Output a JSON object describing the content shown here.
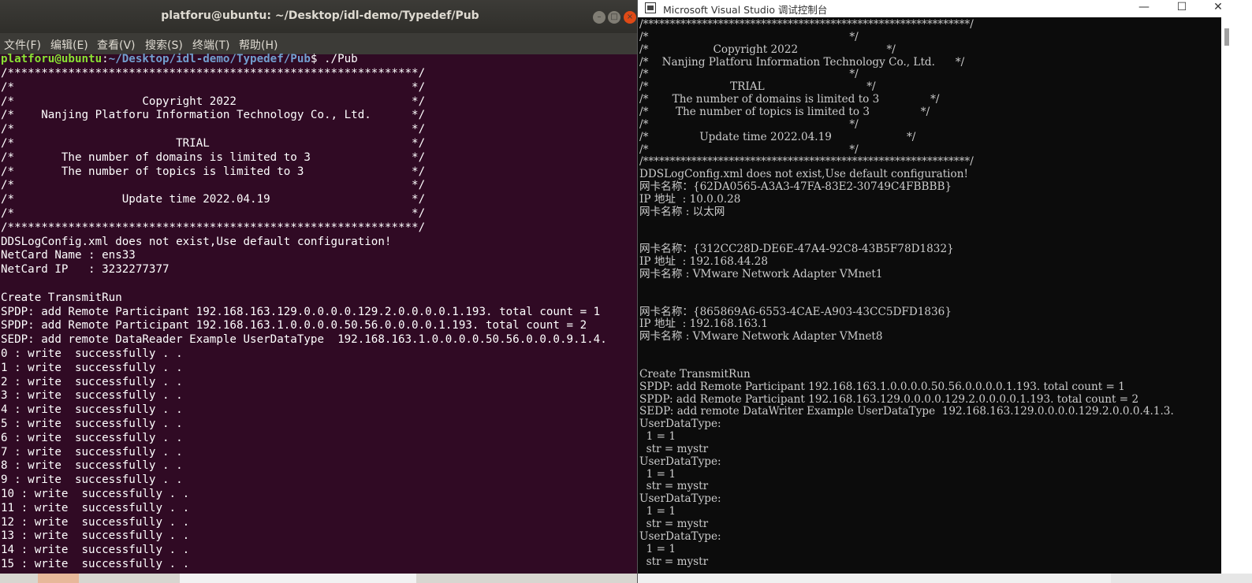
{
  "ubuntu": {
    "title": "platforu@ubuntu: ~/Desktop/idl-demo/Typedef/Pub",
    "controls": {
      "minimize": "–",
      "maximize": "□",
      "close": "×"
    },
    "menus": [
      "文件(F)",
      "编辑(E)",
      "查看(V)",
      "搜索(S)",
      "终端(T)",
      "帮助(H)"
    ],
    "prompt": {
      "user": "platforu@ubuntu",
      "sep": ":",
      "path": "~/Desktop/idl-demo/Typedef/Pub",
      "cmd": "$ ./Pub"
    },
    "lines": [
      "/*************************************************************/",
      "/*                                                           */",
      "/*                   Copyright 2022                          */",
      "/*    Nanjing Platforu Information Technology Co., Ltd.      */",
      "/*                                                           */",
      "/*                        TRIAL                              */",
      "/*       The number of domains is limited to 3               */",
      "/*       The number of topics is limited to 3                */",
      "/*                                                           */",
      "/*                Update time 2022.04.19                     */",
      "/*                                                           */",
      "/*************************************************************/",
      "DDSLogConfig.xml does not exist,Use default configuration!",
      "NetCard Name : ens33",
      "NetCard IP   : 3232277377",
      "",
      "Create TransmitRun",
      "SPDP: add Remote Participant 192.168.163.129.0.0.0.0.129.2.0.0.0.0.1.193. total count = 1",
      "SPDP: add Remote Participant 192.168.163.1.0.0.0.0.50.56.0.0.0.0.1.193. total count = 2",
      "SEDP: add remote DataReader Example UserDataType  192.168.163.1.0.0.0.0.50.56.0.0.0.9.1.4.",
      "0 : write  successfully . .",
      "1 : write  successfully . .",
      "2 : write  successfully . .",
      "3 : write  successfully . .",
      "4 : write  successfully . .",
      "5 : write  successfully . .",
      "6 : write  successfully . .",
      "7 : write  successfully . .",
      "8 : write  successfully . .",
      "9 : write  successfully . .",
      "10 : write  successfully . .",
      "11 : write  successfully . .",
      "12 : write  successfully . .",
      "13 : write  successfully . .",
      "14 : write  successfully . .",
      "15 : write  successfully . ."
    ]
  },
  "windows": {
    "title": "Microsoft Visual Studio 调试控制台",
    "controls": {
      "minimize": "—",
      "maximize": "☐",
      "close": "✕"
    },
    "lines": [
      "/*************************************************************/",
      "/*                                                           */",
      "/*                   Copyright 2022                          */",
      "/*    Nanjing Platforu Information Technology Co., Ltd.      */",
      "/*                                                           */",
      "/*                        TRIAL                              */",
      "/*       The number of domains is limited to 3               */",
      "/*        The number of topics is limited to 3               */",
      "/*                                                           */",
      "/*               Update time 2022.04.19                      */",
      "/*                                                           */",
      "/*************************************************************/",
      "DDSLogConfig.xml does not exist,Use default configuration!",
      "网卡名称：{62DA0565-A3A3-47FA-83E2-30749C4FBBBB}",
      "IP 地址  : 10.0.0.28",
      "网卡名称 : 以太网",
      "",
      "",
      "网卡名称：{312CC28D-DE6E-47A4-92C8-43B5F78D1832}",
      "IP 地址  : 192.168.44.28",
      "网卡名称 : VMware Network Adapter VMnet1",
      "",
      "",
      "网卡名称：{865869A6-6553-4CAE-A903-43CC5DFD1836}",
      "IP 地址  : 192.168.163.1",
      "网卡名称 : VMware Network Adapter VMnet8",
      "",
      "",
      "Create TransmitRun",
      "SPDP: add Remote Participant 192.168.163.1.0.0.0.0.50.56.0.0.0.0.1.193. total count = 1",
      "SPDP: add Remote Participant 192.168.163.129.0.0.0.0.129.2.0.0.0.0.1.193. total count = 2",
      "SEDP: add remote DataWriter Example UserDataType  192.168.163.129.0.0.0.0.129.2.0.0.0.4.1.3.",
      "UserDataType:",
      "  1 = 1",
      "  str = mystr",
      "UserDataType:",
      "  1 = 1",
      "  str = mystr",
      "UserDataType:",
      "  1 = 1",
      "  str = mystr",
      "UserDataType:",
      "  1 = 1",
      "  str = mystr"
    ]
  }
}
